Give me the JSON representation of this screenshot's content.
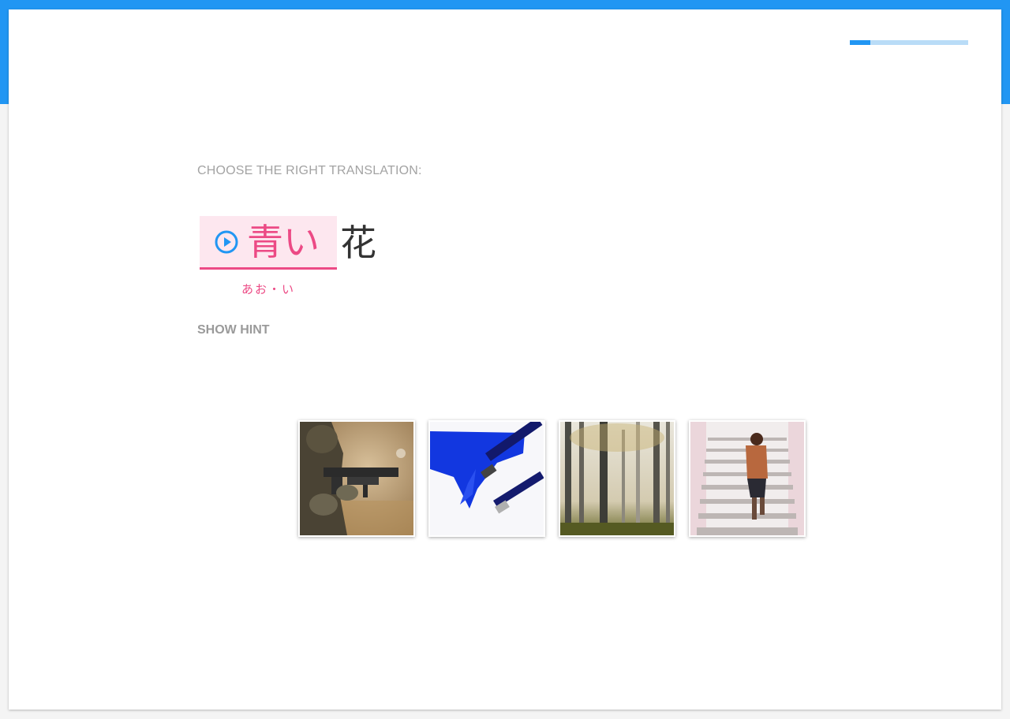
{
  "header": {
    "progress_fraction": 0.17,
    "accent_color": "#2196f3"
  },
  "question": {
    "instruction": "CHOOSE THE RIGHT TRANSLATION:",
    "highlighted_word": "青い",
    "rest_word": "花",
    "reading": "あお・い",
    "play_icon": "play-circle-icon",
    "highlight_color": "#ec4a85"
  },
  "hint": {
    "label": "SHOW HINT"
  },
  "options": [
    {
      "image": "soldier-with-rifle-photo"
    },
    {
      "image": "blue-paint-brushes-photo"
    },
    {
      "image": "foggy-forest-photo"
    },
    {
      "image": "boy-climbing-stairs-photo"
    }
  ]
}
